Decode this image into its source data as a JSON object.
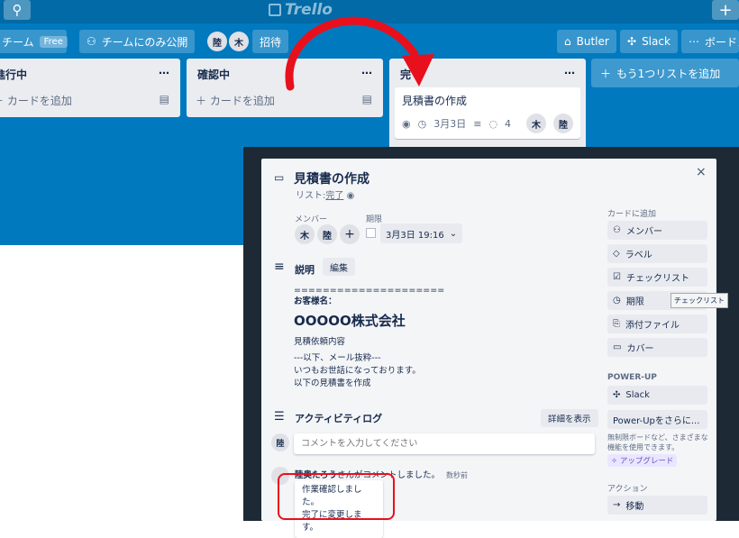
{
  "header": {
    "logo_text": "Trello",
    "team_label": "チーム",
    "free_badge": "Free",
    "visibility_label": "チームにのみ公開",
    "member1": "陸",
    "member2": "木",
    "invite_label": "招待",
    "butler_label": "Butler",
    "slack_label": "Slack",
    "menu_label": "ボードメ"
  },
  "lists": [
    {
      "title": "進行中",
      "add_card": "カードを追加"
    },
    {
      "title": "確認中",
      "add_card": "カードを追加"
    },
    {
      "title": "完",
      "card": {
        "title": "見積書の作成",
        "due": "3月3日",
        "comments": "4",
        "member1": "木",
        "member2": "陸"
      }
    }
  ],
  "add_list_label": "もう1つリストを追加",
  "modal": {
    "title": "見積書の作成",
    "list_prefix": "リスト:",
    "list_name": "完了",
    "members_label": "メンバー",
    "member1": "木",
    "member2": "陸",
    "due_label": "期限",
    "due_value": "3月3日 19:16",
    "description_title": "説明",
    "edit_label": "編集",
    "desc_lines": {
      "rule": "=====================",
      "customer_label": "お客様名：",
      "company": "OOOOO株式会社",
      "request": "見積依頼内容",
      "excerpt": "---以下、メール抜粋---",
      "greeting": "いつもお世話になっております。",
      "body": "以下の見積書を作成"
    },
    "activity_title": "アクティビティログ",
    "show_details": "詳細を表示",
    "commenter_avatar": "陸",
    "comment_placeholder": "コメントを入力してください",
    "comment_author": "陸奥たろう",
    "comment_action": "さんがコメントしました。",
    "comment_time": "数秒前",
    "comment_line1": "作業確認しました。",
    "comment_line2": "完了に変更します。",
    "close_icon": "×",
    "sidebar": {
      "add_to_card": "カードに追加",
      "members": "メンバー",
      "labels": "ラベル",
      "checklist": "チェックリスト",
      "due": "期限",
      "attachment": "添付ファイル",
      "cover": "カバー",
      "powerup_title": "POWER-UP",
      "slack": "Slack",
      "more_powerups": "Power-Upをさらに...",
      "upgrade_note1": "無制限ボードなど、さまざまな",
      "upgrade_note2": "機能を使用できます。",
      "upgrade_badge": "アップグレード",
      "actions_title": "アクション",
      "move": "移動"
    },
    "tooltip": "チェックリスト"
  },
  "annotation_colors": {
    "arrow": "#e8101c",
    "highlight": "#e8101c"
  }
}
